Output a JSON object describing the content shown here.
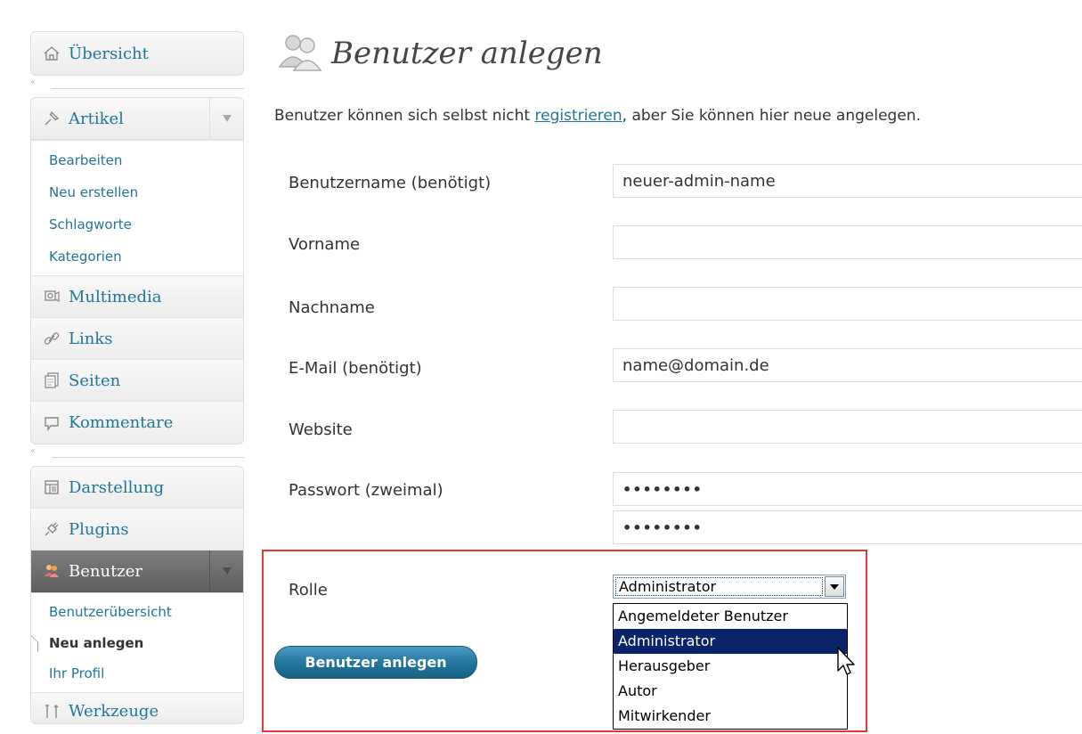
{
  "sidebar": {
    "dashboard": "Übersicht",
    "posts": {
      "label": "Artikel",
      "items": [
        "Bearbeiten",
        "Neu erstellen",
        "Schlagworte",
        "Kategorien"
      ]
    },
    "media": "Multimedia",
    "links": "Links",
    "pages": "Seiten",
    "comments": "Kommentare",
    "appearance": "Darstellung",
    "plugins": "Plugins",
    "users": {
      "label": "Benutzer",
      "items": [
        "Benutzerübersicht",
        "Neu anlegen",
        "Ihr Profil"
      ]
    },
    "tools": "Werkzeuge",
    "collapse_glyph": "«"
  },
  "page": {
    "title": "Benutzer anlegen",
    "intro_before": "Benutzer können sich selbst nicht ",
    "intro_link": "registrieren",
    "intro_after": ", aber Sie können hier neue angelegen."
  },
  "form": {
    "username_label": "Benutzername (benötigt)",
    "username_value": "neuer-admin-name",
    "firstname_label": "Vorname",
    "firstname_value": "",
    "lastname_label": "Nachname",
    "lastname_value": "",
    "email_label": "E-Mail (benötigt)",
    "email_value": "name@domain.de",
    "website_label": "Website",
    "website_value": "",
    "password_label": "Passwort (zweimal)",
    "password1_mask": "••••••••",
    "password2_mask": "••••••••",
    "role_label": "Rolle",
    "role_selected": "Administrator",
    "role_options": [
      "Angemeldeter Benutzer",
      "Administrator",
      "Herausgeber",
      "Autor",
      "Mitwirkender"
    ],
    "submit_label": "Benutzer anlegen"
  },
  "colors": {
    "link": "#21759b",
    "highlight": "#e8353a",
    "option_selected_bg": "#0a246a"
  }
}
